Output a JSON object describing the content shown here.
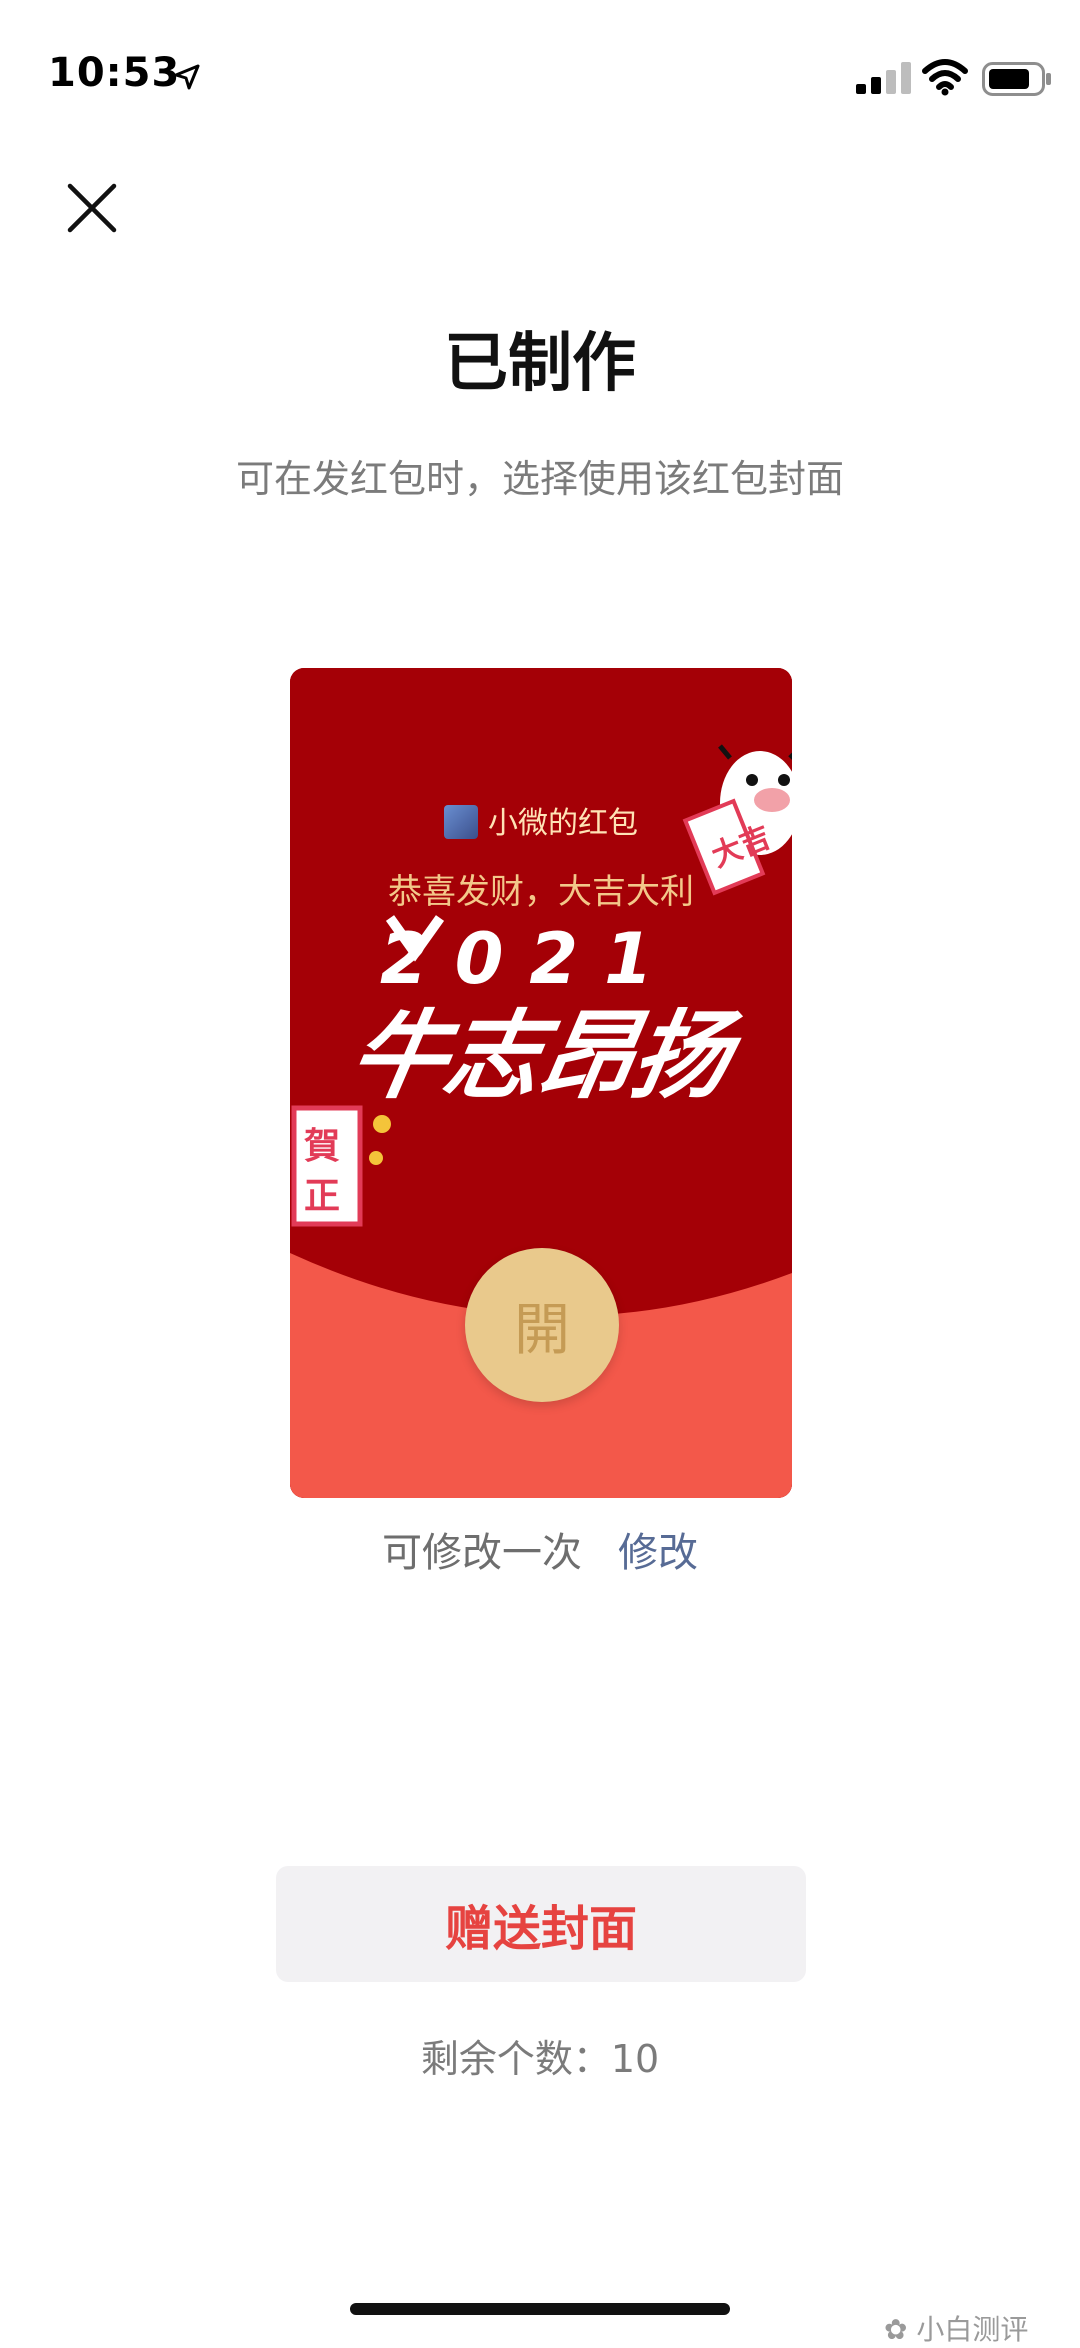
{
  "status_bar": {
    "time": "10:53"
  },
  "header": {
    "title": "已制作",
    "subtitle": "可在发红包时，选择使用该红包封面"
  },
  "cover": {
    "sender_name": "小微的红包",
    "blessing": "恭喜发财，大吉大利",
    "year": "2021",
    "slogan": "牛志昂扬",
    "open_label": "開",
    "colors": {
      "top": "#a40006",
      "bottom": "#f3584a",
      "button": "#e9c98c"
    }
  },
  "modify": {
    "hint": "可修改一次",
    "link": "修改"
  },
  "gift": {
    "label": "赠送封面",
    "remaining": "剩余个数：10"
  },
  "watermark": {
    "text": "小白测评"
  },
  "colors": {
    "accent_red": "#e64340",
    "link_blue": "#576b95"
  }
}
